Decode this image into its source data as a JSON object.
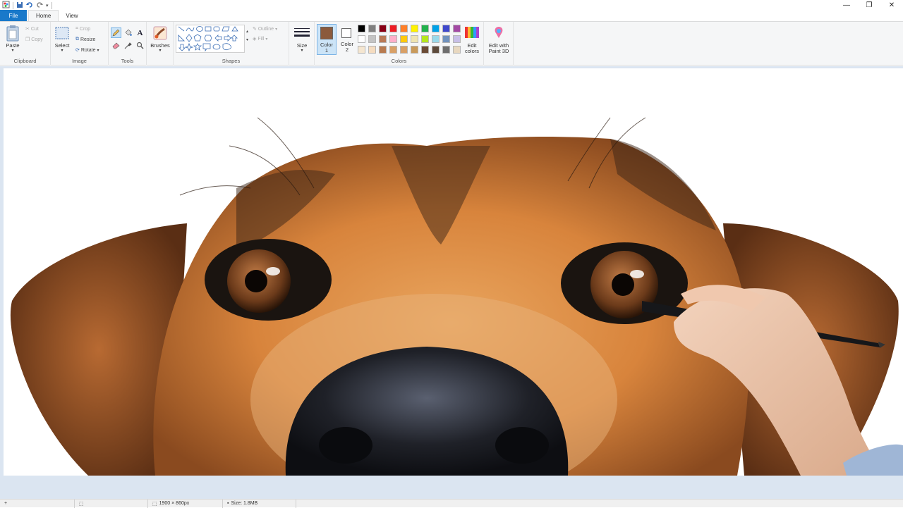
{
  "tabs": {
    "file": "File",
    "home": "Home",
    "view": "View"
  },
  "clipboard": {
    "paste": "Paste",
    "cut": "Cut",
    "copy": "Copy",
    "label": "Clipboard"
  },
  "image": {
    "select": "Select",
    "crop": "Crop",
    "resize": "Resize",
    "rotate": "Rotate",
    "label": "Image"
  },
  "tools": {
    "label": "Tools",
    "text_glyph": "A"
  },
  "brushes": {
    "label": "Brushes"
  },
  "shapes": {
    "outline": "Outline",
    "fill": "Fill",
    "label": "Shapes"
  },
  "size": {
    "label": "Size"
  },
  "colors": {
    "color1": "Color",
    "color1_num": "1",
    "color2": "Color",
    "color2_num": "2",
    "label": "Colors",
    "edit": "Edit",
    "edit2": "colors",
    "paint3d": "Edit with",
    "paint3d2": "Paint 3D",
    "active_color1": "#8b5a3c",
    "palette_row1": [
      "#000000",
      "#7f7f7f",
      "#880015",
      "#ed1c24",
      "#ff7f27",
      "#fff200",
      "#22b14c",
      "#00a2e8",
      "#3f48cc",
      "#a349a4"
    ],
    "palette_row2": [
      "#ffffff",
      "#c3c3c3",
      "#b97a57",
      "#ffaec9",
      "#ffc90e",
      "#efe4b0",
      "#b5e61d",
      "#99d9ea",
      "#7092be",
      "#c8bfe7"
    ],
    "palette_row3": [
      "#f5e6d0",
      "#f5dcc0",
      "#b87b50",
      "#d9a066",
      "#d9a066",
      "#c99a5a",
      "#6b4b35",
      "#5c4a3b",
      "#6e6e6e",
      "#e8d8c0"
    ]
  },
  "status": {
    "dimensions": "1900 × 860px",
    "filesize": "Size: 1.8MB"
  },
  "icons": [
    "paint-app-icon",
    "save-icon",
    "undo-icon",
    "redo-icon",
    "paste-icon",
    "cut-icon",
    "copy-icon",
    "select-icon",
    "crop-icon",
    "resize-icon",
    "rotate-icon",
    "pencil-icon",
    "fill-icon",
    "text-icon",
    "eraser-icon",
    "color-picker-icon",
    "magnifier-icon",
    "brush-icon",
    "size-icon",
    "edit-colors-icon",
    "paint3d-icon",
    "minimize-icon",
    "restore-icon",
    "close-icon"
  ]
}
